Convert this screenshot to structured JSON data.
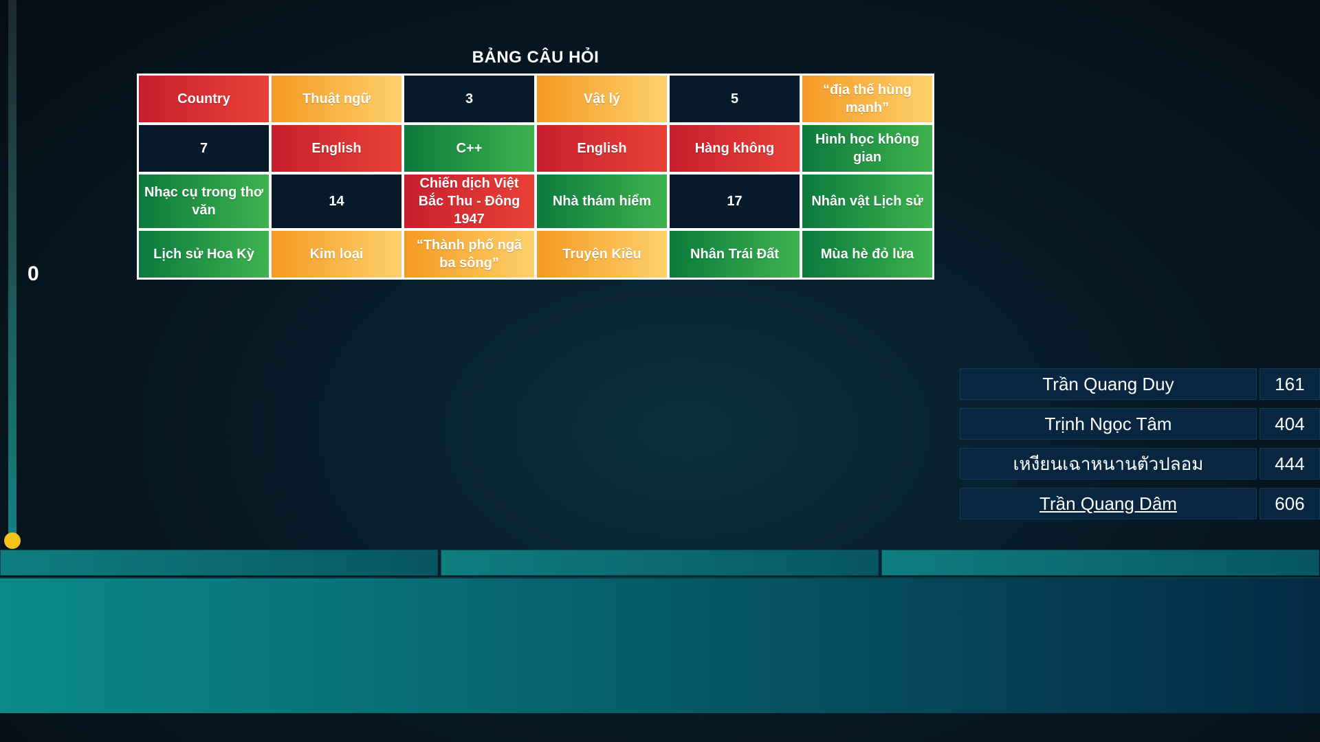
{
  "timer": {
    "value": "0"
  },
  "board": {
    "title": "BẢNG CÂU HỎI",
    "cells": [
      {
        "label": "Country",
        "color": "red"
      },
      {
        "label": "Thuật ngữ",
        "color": "orange"
      },
      {
        "label": "3",
        "color": "dark"
      },
      {
        "label": "Vật lý",
        "color": "orange"
      },
      {
        "label": "5",
        "color": "dark"
      },
      {
        "label": "“địa thế hùng mạnh”",
        "color": "orange"
      },
      {
        "label": "7",
        "color": "dark"
      },
      {
        "label": "English",
        "color": "red"
      },
      {
        "label": "C++",
        "color": "green"
      },
      {
        "label": "English",
        "color": "red"
      },
      {
        "label": "Hàng không",
        "color": "red"
      },
      {
        "label": "Hình học không gian",
        "color": "green"
      },
      {
        "label": "Nhạc cụ trong thơ văn",
        "color": "green"
      },
      {
        "label": "14",
        "color": "dark"
      },
      {
        "label": "Chiến dịch Việt Bắc Thu - Đông 1947",
        "color": "red"
      },
      {
        "label": "Nhà thám hiểm",
        "color": "green"
      },
      {
        "label": "17",
        "color": "dark"
      },
      {
        "label": "Nhân vật Lịch sử",
        "color": "green"
      },
      {
        "label": "Lịch sử Hoa Kỳ",
        "color": "green"
      },
      {
        "label": "Kim loại",
        "color": "orange"
      },
      {
        "label": "“Thành phố ngã ba sông”",
        "color": "orange"
      },
      {
        "label": "Truyện Kiều",
        "color": "orange"
      },
      {
        "label": "Nhân Trái Đất",
        "color": "green"
      },
      {
        "label": "Mùa hè đỏ lửa",
        "color": "green"
      }
    ]
  },
  "scoreboard": {
    "players": [
      {
        "name": "Trần Quang Duy",
        "score": "161",
        "current": false
      },
      {
        "name": "Trịnh Ngọc Tâm",
        "score": "404",
        "current": false
      },
      {
        "name": "เหงียนเฉาหนานตัวปลอม",
        "score": "444",
        "current": false
      },
      {
        "name": "Trần Quang Dâm",
        "score": "606",
        "current": true
      }
    ]
  },
  "colors": {
    "red": "#e23a35",
    "orange": "#f8b040",
    "green": "#2a9e48",
    "dark": "#071a2a",
    "timer_knob": "#f4c21a",
    "panel_teal": "#0b8a8a"
  }
}
